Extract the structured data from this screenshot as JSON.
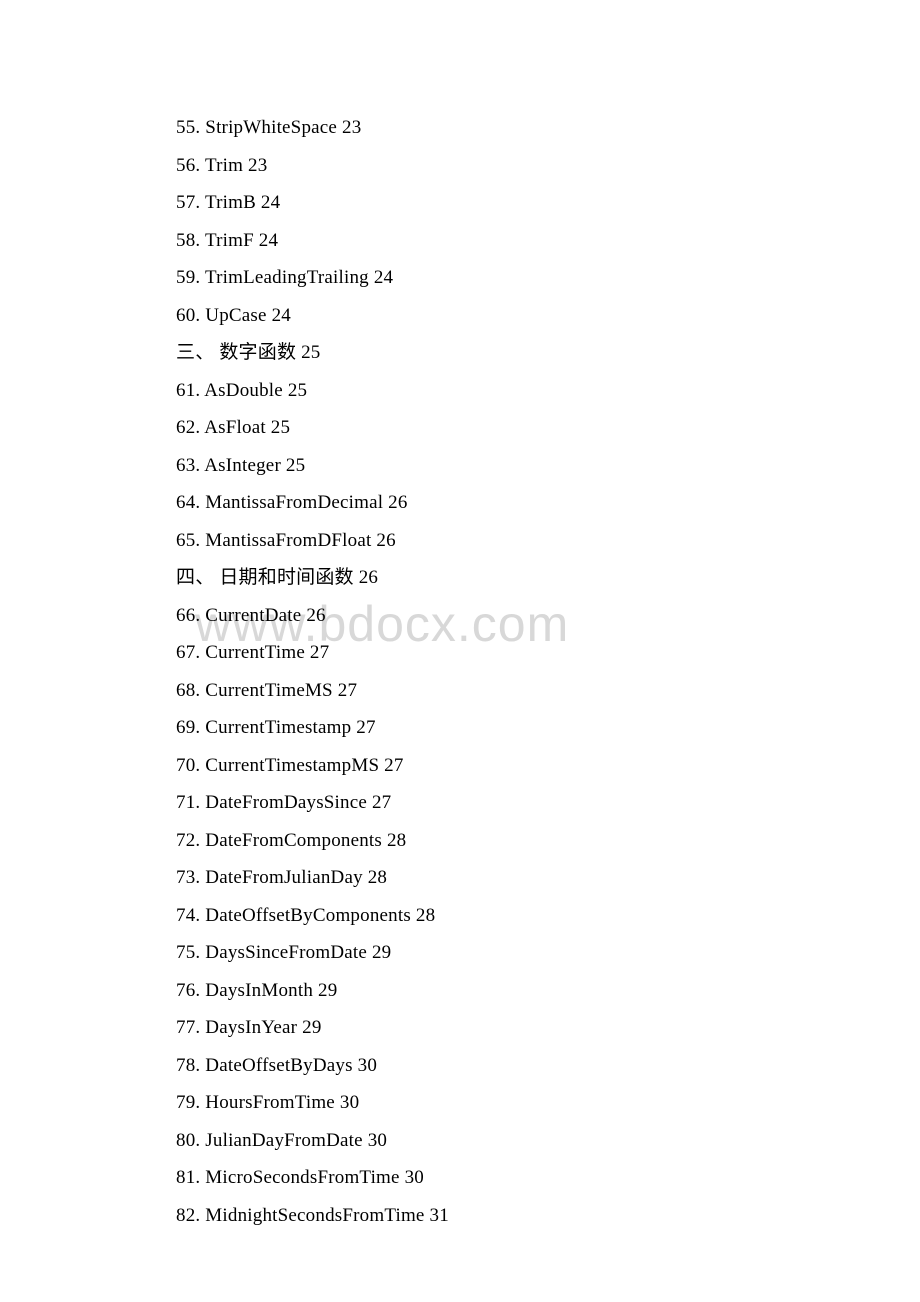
{
  "watermark": "www.bdocx.com",
  "lines": [
    "55. StripWhiteSpace 23",
    "56. Trim 23",
    "57. TrimB 24",
    "58. TrimF 24",
    "59. TrimLeadingTrailing 24",
    "60. UpCase 24",
    "三、 数字函数 25",
    "61. AsDouble 25",
    "62. AsFloat 25",
    "63. AsInteger 25",
    "64. MantissaFromDecimal 26",
    "65. MantissaFromDFloat 26",
    "四、 日期和时间函数 26",
    "66. CurrentDate 26",
    "67. CurrentTime 27",
    "68. CurrentTimeMS 27",
    "69. CurrentTimestamp 27",
    "70. CurrentTimestampMS 27",
    "71. DateFromDaysSince 27",
    "72. DateFromComponents 28",
    "73. DateFromJulianDay 28",
    "74. DateOffsetByComponents 28",
    "75. DaysSinceFromDate 29",
    "76. DaysInMonth 29",
    "77. DaysInYear 29",
    "78. DateOffsetByDays 30",
    "79. HoursFromTime 30",
    "80. JulianDayFromDate 30",
    "81. MicroSecondsFromTime 30",
    "82. MidnightSecondsFromTime 31"
  ]
}
